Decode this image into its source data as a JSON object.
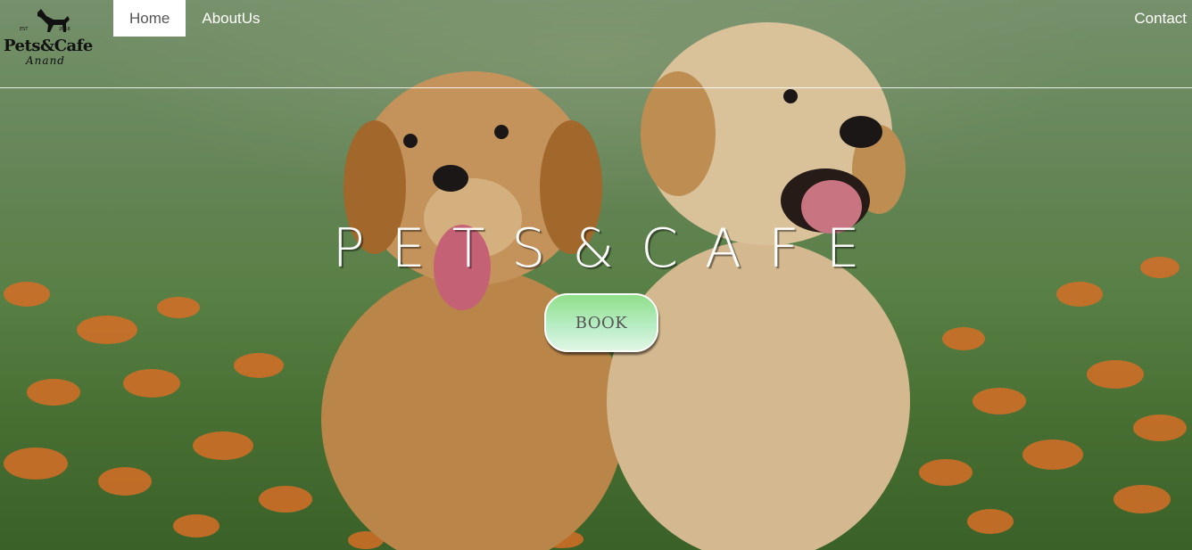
{
  "brand": {
    "logo_title": "Pets&Cafe",
    "logo_subtitle": "Anand",
    "logo_est": "EST",
    "logo_year": "2018",
    "logo_icon": "dog-icon"
  },
  "nav": {
    "items": [
      {
        "label": "Home",
        "active": true
      },
      {
        "label": "AboutUs",
        "active": false
      }
    ],
    "contact_label": "Contact"
  },
  "hero": {
    "title": "PETS&CAFE",
    "book_label": "BOOK",
    "image": "two-golden-puppies-in-flower-meadow"
  },
  "colors": {
    "nav_active_bg": "#ffffff",
    "button_top": "#8fe08a",
    "button_bottom": "#dff6e6",
    "accent_text": "#ffffff"
  }
}
